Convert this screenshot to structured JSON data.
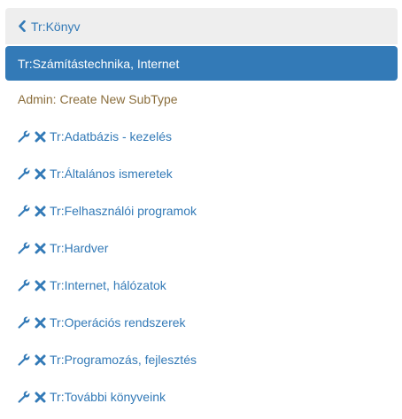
{
  "nav": {
    "back_label": "Tr:Könyv",
    "active_label": "Tr:Számítástechnika, Internet",
    "admin_label": "Admin: Create New SubType",
    "items": [
      {
        "label": "Tr:Adatbázis - kezelés"
      },
      {
        "label": "Tr:Általános ismeretek"
      },
      {
        "label": "Tr:Felhasználói programok"
      },
      {
        "label": "Tr:Hardver"
      },
      {
        "label": "Tr:Internet, hálózatok"
      },
      {
        "label": "Tr:Operációs rendszerek"
      },
      {
        "label": "Tr:Programozás, fejlesztés"
      },
      {
        "label": "Tr:További könyveink"
      }
    ]
  },
  "icons": {
    "back": "chevron-left-icon",
    "edit": "wrench-icon",
    "delete": "close-icon"
  },
  "colors": {
    "link": "#337ab7",
    "active_bg": "#337ab7",
    "back_bg": "#eeeeee",
    "admin_text": "#8a6d3b"
  }
}
